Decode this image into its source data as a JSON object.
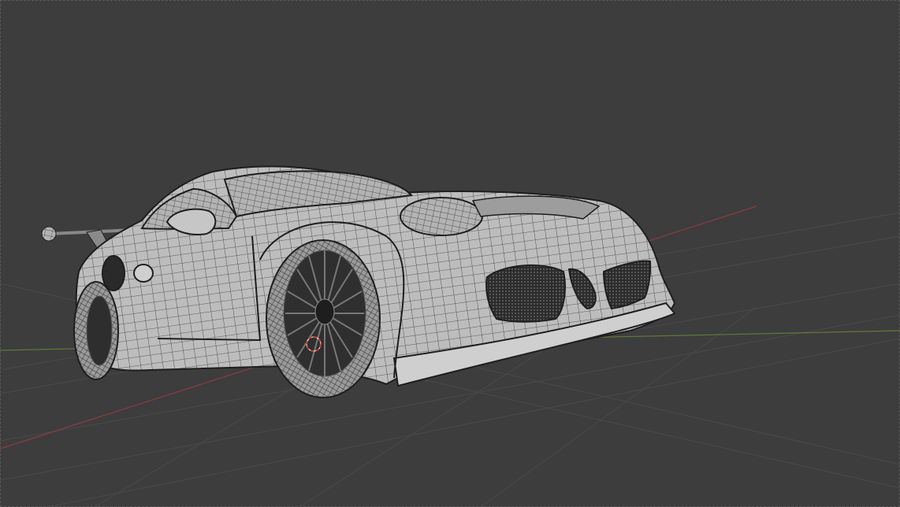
{
  "viewport": {
    "mode": "3D viewport",
    "shading": "solid-wireframe",
    "background_color": "#3d3d3d",
    "grid_color": "#4a4a4a",
    "x_axis_color": "#8a3d44",
    "y_axis_color": "#5f7a3a",
    "cursor_color": "#c83c32"
  },
  "scene": {
    "object": "sports-car",
    "body_color": "#b9b9b9",
    "wire_color": "#2a2a2a"
  }
}
